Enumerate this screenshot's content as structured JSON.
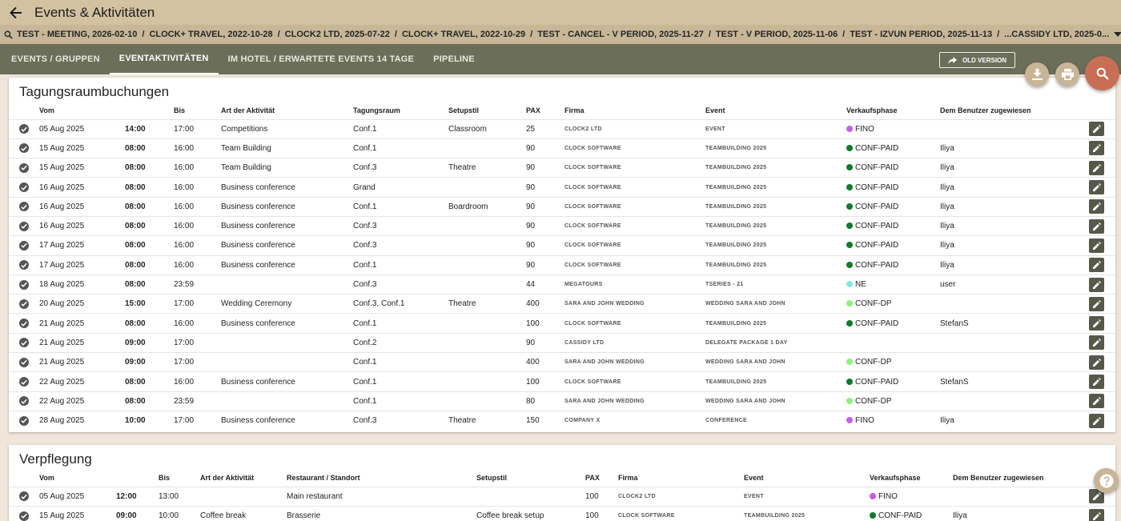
{
  "app": {
    "title": "Events & Aktivitäten"
  },
  "recent": {
    "items": [
      "TEST - MEETING, 2026-02-10",
      "CLOCK+ TRAVEL, 2022-10-28",
      "CLOCK2 LTD, 2025-07-22",
      "CLOCK+ TRAVEL, 2022-10-29",
      "TEST - CANCEL - V PERIOD, 2025-11-27",
      "TEST - V PERIOD, 2025-11-06",
      "TEST - IZVUN PERIOD, 2025-11-13",
      "...CASSIDY LTD, 2025-0..."
    ],
    "separator": "/"
  },
  "nav": {
    "tabs": [
      {
        "label": "EVENTS / GRUPPEN",
        "active": false
      },
      {
        "label": "EVENTAKTIVITÄTEN",
        "active": true
      },
      {
        "label": "IM HOTEL / ERWARTETE EVENTS 14 TAGE",
        "active": false
      },
      {
        "label": "PIPELINE",
        "active": false
      }
    ],
    "old_version": "OLD VERSION"
  },
  "colors": {
    "fino": "#c65de6",
    "conf_paid": "#0f7a2c",
    "ne": "#84e8e0",
    "conf_dp": "#8ef07c",
    "topbar": "#d2c2a0",
    "navbar": "#6b6e59",
    "search_fab": "#c86e55"
  },
  "meetings": {
    "title": "Tagungsraumbuchungen",
    "columns": [
      "Vom",
      "",
      "Bis",
      "Art der Aktivität",
      "Tagungsraum",
      "Setupstil",
      "PAX",
      "Firma",
      "Event",
      "Verkaufsphase",
      "Dem Benutzer zugewiesen"
    ],
    "rows": [
      [
        "05 Aug 2025",
        "14:00",
        "17:00",
        "Competitions",
        "Conf.1",
        "Classroom",
        "25",
        "CLOCK2 LTD",
        "EVENT",
        "FINO",
        ""
      ],
      [
        "15 Aug 2025",
        "08:00",
        "16:00",
        "Team Building",
        "Conf.1",
        "",
        "90",
        "CLOCK SOFTWARE",
        "TEAMBUILDING 2025",
        "CONF-PAID",
        "Iliya"
      ],
      [
        "15 Aug 2025",
        "08:00",
        "16:00",
        "Team Building",
        "Conf.3",
        "Theatre",
        "90",
        "CLOCK SOFTWARE",
        "TEAMBUILDING 2025",
        "CONF-PAID",
        "Iliya"
      ],
      [
        "16 Aug 2025",
        "08:00",
        "16:00",
        "Business conference",
        "Grand",
        "",
        "90",
        "CLOCK SOFTWARE",
        "TEAMBUILDING 2025",
        "CONF-PAID",
        "Iliya"
      ],
      [
        "16 Aug 2025",
        "08:00",
        "16:00",
        "Business conference",
        "Conf.1",
        "Boardroom",
        "90",
        "CLOCK SOFTWARE",
        "TEAMBUILDING 2025",
        "CONF-PAID",
        "Iliya"
      ],
      [
        "16 Aug 2025",
        "08:00",
        "16:00",
        "Business conference",
        "Conf.3",
        "",
        "90",
        "CLOCK SOFTWARE",
        "TEAMBUILDING 2025",
        "CONF-PAID",
        "Iliya"
      ],
      [
        "17 Aug 2025",
        "08:00",
        "16:00",
        "Business conference",
        "Conf.3",
        "",
        "90",
        "CLOCK SOFTWARE",
        "TEAMBUILDING 2025",
        "CONF-PAID",
        "Iliya"
      ],
      [
        "17 Aug 2025",
        "08:00",
        "16:00",
        "Business conference",
        "Conf.1",
        "",
        "90",
        "CLOCK SOFTWARE",
        "TEAMBUILDING 2025",
        "CONF-PAID",
        "Iliya"
      ],
      [
        "18 Aug 2025",
        "08:00",
        "23:59",
        "",
        "Conf.3",
        "",
        "44",
        "MEGATOURS",
        "TSERIES - 21",
        "NE",
        "user"
      ],
      [
        "20 Aug 2025",
        "15:00",
        "17:00",
        "Wedding Ceremony",
        "Conf.3, Conf.1",
        "Theatre",
        "400",
        "SARA AND JOHN WEDDING",
        "WEDDING SARA AND JOHN",
        "CONF-DP",
        ""
      ],
      [
        "21 Aug 2025",
        "08:00",
        "16:00",
        "Business conference",
        "Conf.1",
        "",
        "100",
        "CLOCK SOFTWARE",
        "TEAMBUILDING 2025",
        "CONF-PAID",
        "StefanS"
      ],
      [
        "21 Aug 2025",
        "09:00",
        "17:00",
        "",
        "Conf.2",
        "",
        "90",
        "CASSIDY LTD",
        "DELEGATE PACKAGE 1 DAY",
        "",
        ""
      ],
      [
        "21 Aug 2025",
        "09:00",
        "17:00",
        "",
        "Conf.1",
        "",
        "400",
        "SARA AND JOHN WEDDING",
        "WEDDING SARA AND JOHN",
        "CONF-DP",
        ""
      ],
      [
        "22 Aug 2025",
        "08:00",
        "16:00",
        "Business conference",
        "Conf.1",
        "",
        "100",
        "CLOCK SOFTWARE",
        "TEAMBUILDING 2025",
        "CONF-PAID",
        "StefanS"
      ],
      [
        "22 Aug 2025",
        "08:00",
        "23:59",
        "",
        "Conf.1",
        "",
        "80",
        "SARA AND JOHN WEDDING",
        "WEDDING SARA AND JOHN",
        "CONF-DP",
        ""
      ],
      [
        "28 Aug 2025",
        "10:00",
        "17:00",
        "Business conference",
        "Conf.3",
        "Theatre",
        "150",
        "COMPANY X",
        "CONFERENCE",
        "FINO",
        "Iliya"
      ]
    ]
  },
  "catering": {
    "title": "Verpflegung",
    "columns": [
      "Vom",
      "",
      "Bis",
      "Art der Aktivität",
      "Restaurant / Standort",
      "Setupstil",
      "PAX",
      "Firma",
      "Event",
      "Verkaufsphase",
      "Dem Benutzer zugewiesen"
    ],
    "rows": [
      [
        "05 Aug 2025",
        "12:00",
        "13:00",
        "",
        "Main restaurant",
        "",
        "100",
        "CLOCK2 LTD",
        "EVENT",
        "FINO",
        ""
      ],
      [
        "15 Aug 2025",
        "09:00",
        "10:00",
        "Coffee break",
        "Brasserie",
        "Coffee break setup",
        "100",
        "CLOCK SOFTWARE",
        "TEAMBUILDING 2025",
        "CONF-PAID",
        "Iliya"
      ]
    ]
  }
}
